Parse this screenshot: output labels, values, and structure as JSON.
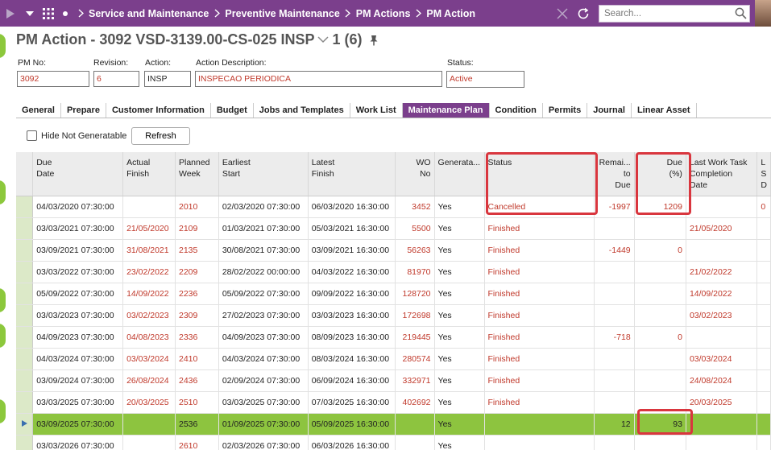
{
  "breadcrumbs": [
    "Service and Maintenance",
    "Preventive Maintenance",
    "PM Actions",
    "PM Action"
  ],
  "search": {
    "placeholder": "Search..."
  },
  "title": {
    "text": "PM Action - 3092 VSD-3139.00-CS-025 INSP",
    "count": "1 (6)"
  },
  "fields": {
    "pm_no": {
      "label": "PM No:",
      "value": "3092"
    },
    "revision": {
      "label": "Revision:",
      "value": "6"
    },
    "action": {
      "label": "Action:",
      "value": "INSP"
    },
    "action_description": {
      "label": "Action Description:",
      "value": "INSPECAO PERIODICA"
    },
    "status": {
      "label": "Status:",
      "value": "Active"
    }
  },
  "tabs": [
    "General",
    "Prepare",
    "Customer Information",
    "Budget",
    "Jobs and Templates",
    "Work List",
    "Maintenance Plan",
    "Condition",
    "Permits",
    "Journal",
    "Linear Asset"
  ],
  "active_tab": "Maintenance Plan",
  "controls": {
    "hide_not_generatable": "Hide Not Generatable",
    "refresh": "Refresh"
  },
  "grid": {
    "columns": [
      {
        "l1": "Due",
        "l2": "Date",
        "l3": ""
      },
      {
        "l1": "Actual",
        "l2": "Finish",
        "l3": ""
      },
      {
        "l1": "Planned",
        "l2": "Week",
        "l3": ""
      },
      {
        "l1": "Earliest",
        "l2": "Start",
        "l3": ""
      },
      {
        "l1": "Latest",
        "l2": "Finish",
        "l3": ""
      },
      {
        "l1": "WO",
        "l2": "No",
        "l3": ""
      },
      {
        "l1": "Generata...",
        "l2": "",
        "l3": ""
      },
      {
        "l1": "Status",
        "l2": "",
        "l3": ""
      },
      {
        "l1": "Remai...",
        "l2": "to",
        "l3": "Due"
      },
      {
        "l1": "Due",
        "l2": "(%)",
        "l3": ""
      },
      {
        "l1": "Last Work Task",
        "l2": "Completion",
        "l3": "Date"
      },
      {
        "l1": "L",
        "l2": "S",
        "l3": "D"
      }
    ],
    "rows": [
      [
        "04/03/2020 07:30:00",
        "",
        "2010",
        "02/03/2020 07:30:00",
        "06/03/2020 16:30:00",
        "3452",
        "Yes",
        "Cancelled",
        "-1997",
        "1209",
        "",
        "0"
      ],
      [
        "03/03/2021 07:30:00",
        "21/05/2020",
        "2109",
        "01/03/2021 07:30:00",
        "05/03/2021 16:30:00",
        "5500",
        "Yes",
        "Finished",
        "",
        "",
        "21/05/2020",
        ""
      ],
      [
        "03/09/2021 07:30:00",
        "31/08/2021",
        "2135",
        "30/08/2021 07:30:00",
        "03/09/2021 16:30:00",
        "56263",
        "Yes",
        "Finished",
        "-1449",
        "0",
        "",
        ""
      ],
      [
        "03/03/2022 07:30:00",
        "23/02/2022",
        "2209",
        "28/02/2022 00:00:00",
        "04/03/2022 16:30:00",
        "81970",
        "Yes",
        "Finished",
        "",
        "",
        "21/02/2022",
        ""
      ],
      [
        "05/09/2022 07:30:00",
        "14/09/2022",
        "2236",
        "05/09/2022 07:30:00",
        "09/09/2022 16:30:00",
        "128720",
        "Yes",
        "Finished",
        "",
        "",
        "14/09/2022",
        ""
      ],
      [
        "03/03/2023 07:30:00",
        "03/02/2023",
        "2309",
        "27/02/2023 07:30:00",
        "03/03/2023 16:30:00",
        "172698",
        "Yes",
        "Finished",
        "",
        "",
        "03/02/2023",
        ""
      ],
      [
        "04/09/2023 07:30:00",
        "04/08/2023",
        "2336",
        "04/09/2023 07:30:00",
        "08/09/2023 16:30:00",
        "219445",
        "Yes",
        "Finished",
        "-718",
        "0",
        "",
        ""
      ],
      [
        "04/03/2024 07:30:00",
        "03/03/2024",
        "2410",
        "04/03/2024 07:30:00",
        "08/03/2024 16:30:00",
        "280574",
        "Yes",
        "Finished",
        "",
        "",
        "03/03/2024",
        ""
      ],
      [
        "03/09/2024 07:30:00",
        "26/08/2024",
        "2436",
        "02/09/2024 07:30:00",
        "06/09/2024 16:30:00",
        "332971",
        "Yes",
        "Finished",
        "",
        "",
        "24/08/2024",
        ""
      ],
      [
        "03/03/2025 07:30:00",
        "20/03/2025",
        "2510",
        "03/03/2025 07:30:00",
        "07/03/2025 16:30:00",
        "402692",
        "Yes",
        "Finished",
        "",
        "",
        "20/03/2025",
        ""
      ],
      [
        "03/09/2025 07:30:00",
        "",
        "2536",
        "01/09/2025 07:30:00",
        "05/09/2025 16:30:00",
        "",
        "Yes",
        "",
        "12",
        "93",
        "",
        ""
      ],
      [
        "03/03/2026 07:30:00",
        "",
        "2610",
        "02/03/2026 07:30:00",
        "06/03/2026 16:30:00",
        "",
        "Yes",
        "",
        "",
        "",
        "",
        ""
      ]
    ],
    "selected_row": 10
  },
  "colors": {
    "brand": "#7b3f8c",
    "selected_row": "#8dc43f",
    "value_red": "#c0392b",
    "highlight": "#d9363e"
  }
}
